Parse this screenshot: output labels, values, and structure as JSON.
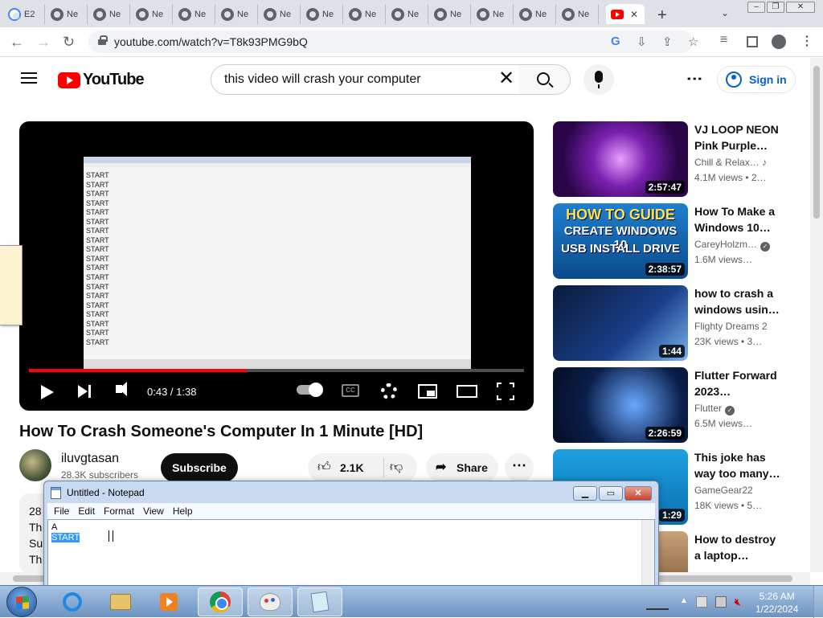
{
  "browser": {
    "tabs": [
      {
        "label": "E2",
        "icon": "google-icon"
      },
      {
        "label": "Ne"
      },
      {
        "label": "Ne"
      },
      {
        "label": "Ne"
      },
      {
        "label": "Ne"
      },
      {
        "label": "Ne"
      },
      {
        "label": "Ne"
      },
      {
        "label": "Ne"
      },
      {
        "label": "Ne"
      },
      {
        "label": "Ne"
      },
      {
        "label": "Ne"
      },
      {
        "label": "Ne"
      },
      {
        "label": "Ne"
      },
      {
        "label": "Ne"
      }
    ],
    "active_tab_close": "✕",
    "new_tab": "+",
    "tab_menu": "⌄",
    "url": "youtube.com/watch?v=T8k93PMG9bQ"
  },
  "youtube": {
    "logo_text": "YouTube",
    "search_value": "this video will crash your computer",
    "sign_in": "Sign in",
    "player": {
      "screen_lines": [
        "START",
        "START",
        "START",
        "START",
        "START",
        "START",
        "START",
        "START",
        "START",
        "START",
        "START",
        "START",
        "START",
        "START",
        "START",
        "START",
        "START",
        "START",
        "START"
      ],
      "time": "0:43 / 1:38",
      "progress": 0.44,
      "cc": "CC"
    },
    "video_title": "How To Crash Someone's Computer In 1 Minute [HD]",
    "channel_name": "iluvgtasan",
    "subscribers": "28.3K subscribers",
    "subscribe_label": "Subscribe",
    "likes": "2.1K",
    "share_label": "Share",
    "description_lines": [
      "28",
      "Th",
      "Su",
      "Th"
    ],
    "recommendations": [
      {
        "title": "VJ LOOP NEON Pink Purple…",
        "channel": "Chill & Relax…",
        "views": "4.1M views • 2…",
        "duration": "2:57:47",
        "verified": false,
        "music": true
      },
      {
        "title": "How To Make a Windows 10…",
        "channel": "CareyHolzm…",
        "views": "1.6M views…",
        "duration": "2:38:57",
        "verified": true,
        "thumb_text": [
          "HOW TO GUIDE",
          "CREATE WINDOWS 10",
          "USB INSTALL DRIVE"
        ]
      },
      {
        "title": "how to crash a windows usin…",
        "channel": "Flighty Dreams 2",
        "views": "23K views • 3…",
        "duration": "1:44",
        "verified": false
      },
      {
        "title": "Flutter Forward 2023…",
        "channel": "Flutter",
        "views": "6.5M views…",
        "duration": "2:26:59",
        "verified": true
      },
      {
        "title": "This joke has way too many…",
        "channel": "GameGear22",
        "views": "18K views • 5…",
        "duration": "1:29",
        "verified": false
      },
      {
        "title": "How to destroy a laptop…",
        "channel": "",
        "views": "",
        "duration": "",
        "verified": false
      }
    ]
  },
  "notepad": {
    "title": "Untitled - Notepad",
    "menu": [
      "File",
      "Edit",
      "Format",
      "View",
      "Help"
    ],
    "line1": "A",
    "selected_text": "START"
  },
  "taskbar": {
    "time": "5:26 AM",
    "date": "1/22/2024"
  }
}
